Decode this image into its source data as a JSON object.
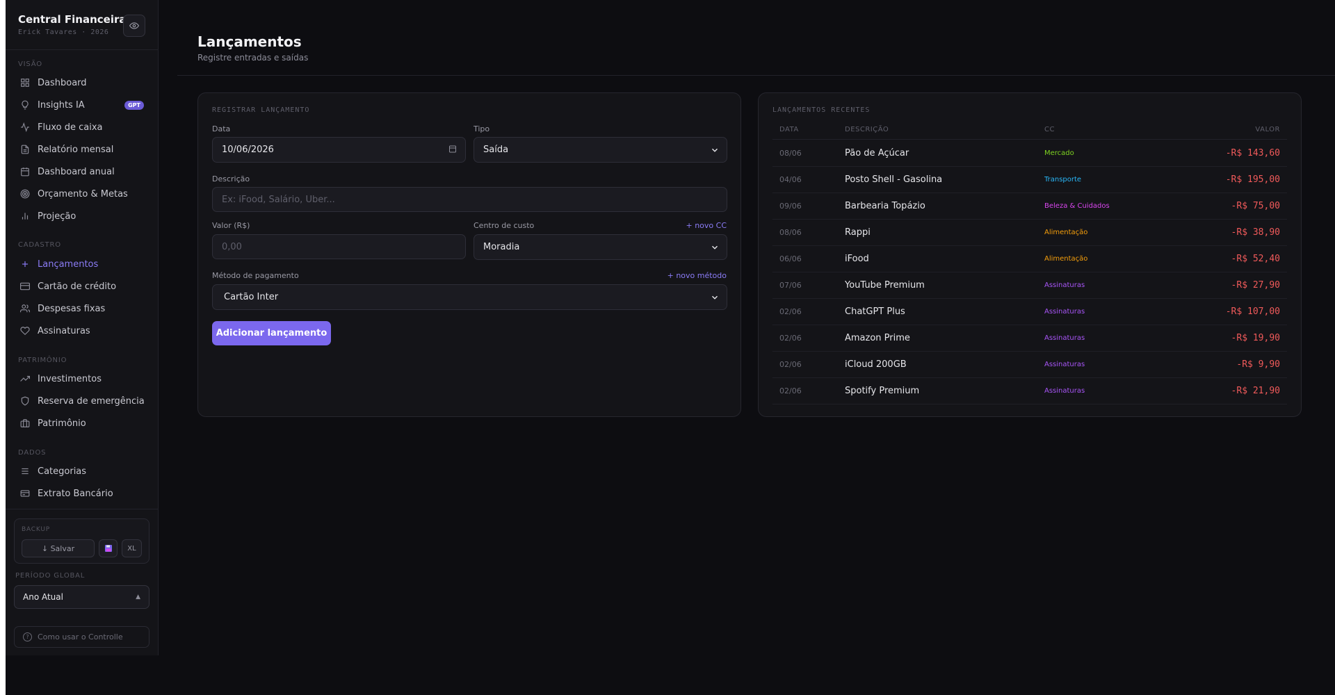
{
  "app": {
    "title": "Central Financeira",
    "subtitle": "Erick Tavares · 2026"
  },
  "sidebar": {
    "sections": {
      "visao": "VISÃO",
      "cadastro": "CADASTRO",
      "patrimonio": "PATRIMÔNIO",
      "dados": "DADOS"
    },
    "items": {
      "dashboard": "Dashboard",
      "insights": "Insights IA",
      "insights_badge": "GPT",
      "fluxo": "Fluxo de caixa",
      "relatorio": "Relatório mensal",
      "dashboard_anual": "Dashboard anual",
      "orcamento": "Orçamento & Metas",
      "projecao": "Projeção",
      "lancamentos": "Lançamentos",
      "cartao": "Cartão de crédito",
      "despesas": "Despesas fixas",
      "assinaturas": "Assinaturas",
      "investimentos": "Investimentos",
      "reserva": "Reserva de emergência",
      "patrimonio": "Patrimônio",
      "categorias": "Categorias",
      "extrato": "Extrato Bancário"
    },
    "backup": {
      "label": "BACKUP",
      "save": "↓ Salvar",
      "xl": "XL"
    },
    "periodo": {
      "label": "PERÍODO GLOBAL",
      "value": "Ano Atual"
    },
    "help": "Como usar o Controlle"
  },
  "header": {
    "title": "Lançamentos",
    "subtitle": "Registre entradas e saídas"
  },
  "form": {
    "title": "REGISTRAR LANÇAMENTO",
    "data_label": "Data",
    "data_value": "10/06/2026",
    "tipo_label": "Tipo",
    "tipo_value": "Saída",
    "descricao_label": "Descrição",
    "descricao_placeholder": "Ex: iFood, Salário, Uber...",
    "valor_label": "Valor (R$)",
    "valor_placeholder": "0,00",
    "cc_label": "Centro de custo",
    "cc_link": "+ novo CC",
    "cc_value": "Moradia",
    "metodo_label": "Método de pagamento",
    "metodo_link": "+ novo método",
    "metodo_value": "Cartão Inter",
    "submit": "Adicionar lançamento"
  },
  "recent": {
    "title": "LANÇAMENTOS RECENTES",
    "headers": {
      "date": "DATA",
      "desc": "DESCRIÇÃO",
      "cc": "CC",
      "value": "VALOR"
    },
    "rows": [
      {
        "date": "08/06",
        "desc": "Pão de Açúcar",
        "cc": "Mercado",
        "cc_color": "#7ed321",
        "value": "-R$ 143,60"
      },
      {
        "date": "04/06",
        "desc": "Posto Shell - Gasolina",
        "cc": "Transporte",
        "cc_color": "#29b6f6",
        "value": "-R$ 195,00"
      },
      {
        "date": "09/06",
        "desc": "Barbearia Topázio",
        "cc": "Beleza & Cuidados",
        "cc_color": "#d946ef",
        "value": "-R$ 75,00"
      },
      {
        "date": "08/06",
        "desc": "Rappi",
        "cc": "Alimentação",
        "cc_color": "#f59e0b",
        "value": "-R$ 38,90"
      },
      {
        "date": "06/06",
        "desc": "iFood",
        "cc": "Alimentação",
        "cc_color": "#f59e0b",
        "value": "-R$ 52,40"
      },
      {
        "date": "07/06",
        "desc": "YouTube Premium",
        "cc": "Assinaturas",
        "cc_color": "#a855f7",
        "value": "-R$ 27,90"
      },
      {
        "date": "02/06",
        "desc": "ChatGPT Plus",
        "cc": "Assinaturas",
        "cc_color": "#a855f7",
        "value": "-R$ 107,00"
      },
      {
        "date": "02/06",
        "desc": "Amazon Prime",
        "cc": "Assinaturas",
        "cc_color": "#a855f7",
        "value": "-R$ 19,90"
      },
      {
        "date": "02/06",
        "desc": "iCloud 200GB",
        "cc": "Assinaturas",
        "cc_color": "#a855f7",
        "value": "-R$ 9,90"
      },
      {
        "date": "02/06",
        "desc": "Spotify Premium",
        "cc": "Assinaturas",
        "cc_color": "#a855f7",
        "value": "-R$ 21,90"
      }
    ]
  },
  "colors": {
    "accent": "#7b68ee",
    "negative": "#f05a5a",
    "background": "#0d0d11",
    "panel": "#141418"
  }
}
